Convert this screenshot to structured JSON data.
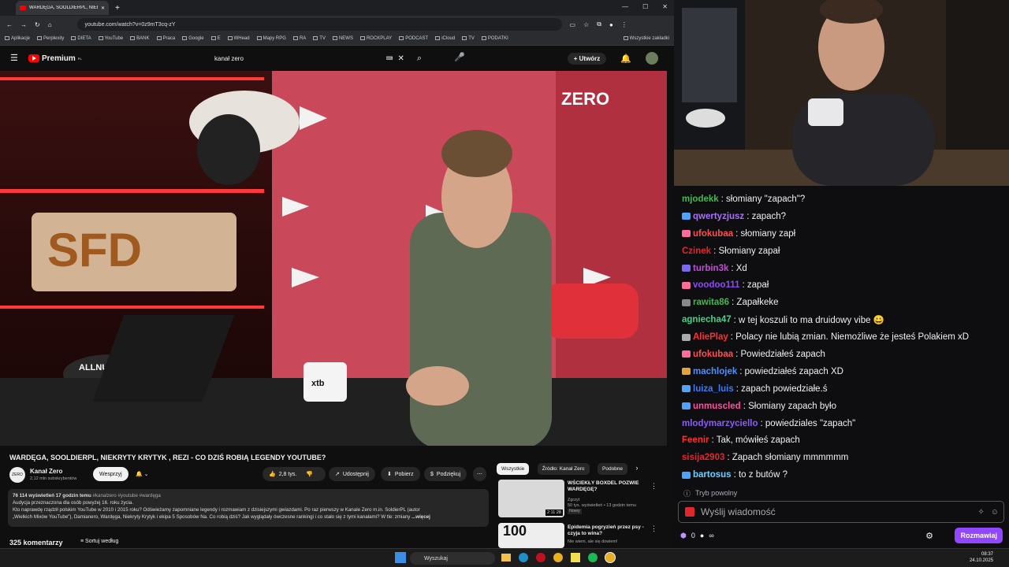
{
  "browser": {
    "tab_title": "WARDĘGA, SOOLDIERPL, NIEKRY…",
    "url": "youtube.com/watch?v=0z9mT3cq-zY",
    "bookmarks": [
      "Aplikacje",
      "Perplexity",
      "DIETA",
      "YouTube",
      "BANK",
      "Praca",
      "Google",
      "E",
      "WHead",
      "Mapy RPG",
      "RA",
      "TV",
      "NEWS",
      "ROCKPLAY",
      "PODCAST",
      "iCloud",
      "TV",
      "PODATKI"
    ],
    "all_bookmarks": "Wszystkie zakładki"
  },
  "yt": {
    "logo": "Premium",
    "logo_sup": "PL",
    "search_value": "kanał zero",
    "create_label": "Utwórz",
    "video_title": "WARDĘGA, SOOLDIERPL, NIEKRYTY KRYTYK , REZI - CO DZIŚ ROBIĄ LEGENDY YOUTUBE?",
    "overlay_zero": "ZERO",
    "overlay_sfd": "SFD",
    "overlay_allnutrition": "ALLNUTRITION",
    "overlay_xtb": "xtb",
    "channel": {
      "avatar": "ZERO",
      "name": "Kanał Zero",
      "subs": "2,12 mln subskrybentów",
      "support": "Wesprzyj"
    },
    "actions": {
      "likes": "2,8 tys.",
      "share": "Udostępnij",
      "download": "Pobierz",
      "thanks": "Podziękuj"
    },
    "desc": {
      "meta": "76 114 wyświetleń  17 godzin temu",
      "tags": "#kanalzero #youtube #wardęga",
      "line1": "Audycja przeznaczona dla osób powyżej 16. roku życia.",
      "line2": "Kto naprawdę rządził polskim YouTube w 2010 i 2015 roku? Odświeżamy zapomniane legendy i rozmawiam z dzisiejszymi gwiazdami. Po raz pierwszy w Kanale Zero m.in. SoldierPL (autor",
      "line3": "„Wielkich Mixów YouTube”), Damianero, Wardęga, Niekryty Krytyk i ekipa 5 Sposobów Na. Co robią dziś? Jak wyglądały ówczesne rankingi i co stało się z tymi kanałami? W tle: zmiany",
      "more": "...więcej"
    },
    "comments": "325 komentarzy",
    "sort": "Sortuj według",
    "chips": [
      "Wszystkie",
      "Źródło: Kanał Zero",
      "Podobne"
    ],
    "related": [
      {
        "title": "WŚCIEKŁY BOXDEL POZWIE WARDĘGĘ?",
        "channel": "Zgrzyt",
        "meta": "50 tys. wyświetleń • 13 godzin temu",
        "badge": "Nowy",
        "duration": "2:11:28"
      },
      {
        "title": "Epidemia pogryzień przez psy - czyja to wina?",
        "channel": "Nie wiem, ale się dowiem!",
        "thumb_text": "100"
      }
    ]
  },
  "chat": {
    "messages": [
      {
        "user": "mjodekk",
        "color": "#3fb950",
        "text": ": słomiany \"zapach\"?",
        "badge": ""
      },
      {
        "user": "qwertyzjusz",
        "color": "#a970ff",
        "text": ": zapach?",
        "badge": "#4fa3ff"
      },
      {
        "user": "ufokubaa",
        "color": "#ff4f4f",
        "text": ": słomiany zapł",
        "badge": "#ff6b9a"
      },
      {
        "user": "Czinek",
        "color": "#e0272e",
        "text": ": Słomiany zapał",
        "badge": ""
      },
      {
        "user": "turbin3k",
        "color": "#c04fd6",
        "text": ": Xd",
        "badge": "#7b68ee"
      },
      {
        "user": "voodoo111",
        "color": "#9146ff",
        "text": ": zapał",
        "badge": "#ff6b9a"
      },
      {
        "user": "rawita86",
        "color": "#3fb950",
        "text": ": Zapałkeke",
        "badge": "#888"
      },
      {
        "user": "agniecha47",
        "color": "#44d18b",
        "text": ": w tej koszuli to ma druidowy vibe 😀",
        "badge": ""
      },
      {
        "user": "AliePlay",
        "color": "#ff3030",
        "text": ": Polacy nie lubią zmian. Niemożliwe że jesteś Polakiem xD",
        "badge": "#aaa"
      },
      {
        "user": "ufokubaa",
        "color": "#ff4f4f",
        "text": ": Powiedziałeś zapach",
        "badge": "#ff6b9a"
      },
      {
        "user": "machlojek",
        "color": "#4f8fff",
        "text": ": powiedziałeś zapach XD",
        "badge": "#e2a33b"
      },
      {
        "user": "luiza_luis",
        "color": "#3a7bff",
        "text": ": zapach powiedziałe.ś",
        "badge": "#4fa3ff"
      },
      {
        "user": "unmuscled",
        "color": "#ff4f9f",
        "text": ": Słomiany zapach było",
        "badge": "#4fa3ff"
      },
      {
        "user": "mlodymarzyciello",
        "color": "#8b5cf6",
        "text": ": powiedziales \"zapach\"",
        "badge": ""
      },
      {
        "user": "Feenir",
        "color": "#ff3030",
        "text": ": Tak, mówiłeś zapach",
        "badge": ""
      },
      {
        "user": "sisija2903",
        "color": "#e0272e",
        "text": ": Zapach słomiany mmmmmm",
        "badge": ""
      },
      {
        "user": "bartosus",
        "color": "#6fd0ff",
        "text": ": to z butów ?",
        "badge": "#4fa3ff"
      }
    ],
    "slow_mode": "Tryb powolny",
    "placeholder": "Wyślij wiadomość",
    "points": "0",
    "send": "Rozmawiaj"
  },
  "taskbar": {
    "search": "Wyszukaj",
    "time": "08:37",
    "date": "24.10.2025"
  }
}
